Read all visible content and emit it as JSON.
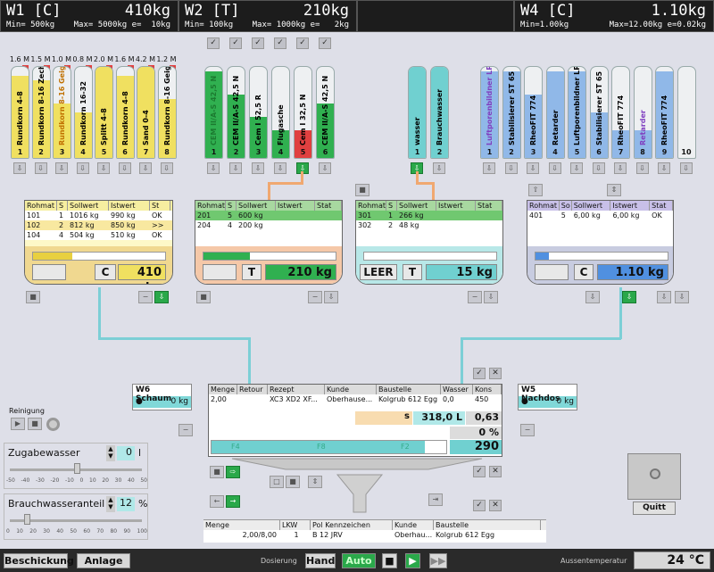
{
  "scales": [
    {
      "name": "W1",
      "mode": "[C]",
      "weight": "410kg",
      "min": "Min= 500kg",
      "max": "Max= 5000kg",
      "e": "e=  10kg"
    },
    {
      "name": "W2",
      "mode": "[T]",
      "weight": "210kg",
      "min": "Min= 100kg",
      "max": "Max= 1000kg",
      "e": "e=   2kg"
    },
    {
      "name": "W4",
      "mode": "[C]",
      "weight": "1.10kg",
      "min": "Min=1.00kg",
      "max": "Max=12.00kg",
      "e": "e=0.02kg"
    }
  ],
  "silos_w1": [
    {
      "qty": "1.6 M",
      "name": "Rundkorn 4-8",
      "num": "1",
      "level": 0.9,
      "color": "#f0e060",
      "text": "#000"
    },
    {
      "qty": "1.5 M",
      "name": "Rundkorn 8-16 Zech",
      "num": "2",
      "level": 0.85,
      "color": "#f0e060",
      "text": "#000"
    },
    {
      "qty": "1.0 M",
      "name": "Rundkorn 8-16 Geig",
      "num": "3",
      "level": 0.6,
      "color": "#f0e060",
      "text": "#c07000"
    },
    {
      "qty": "0.8 M",
      "name": "Rundkorn 16-32",
      "num": "4",
      "level": 0.5,
      "color": "#f0e060",
      "text": "#000"
    },
    {
      "qty": "2.0 M",
      "name": "Splitt 4-8",
      "num": "5",
      "level": 1.0,
      "color": "#f0e060",
      "text": "#000"
    },
    {
      "qty": "1.6 M",
      "name": "Rundkorn 4-8",
      "num": "6",
      "level": 0.9,
      "color": "#f0e060",
      "text": "#000"
    },
    {
      "qty": "4.2 M",
      "name": "Sand 0-4",
      "num": "7",
      "level": 1.0,
      "color": "#f0e060",
      "text": "#000"
    },
    {
      "qty": "1.2 M",
      "name": "Rundkorn 8-16 Geig",
      "num": "8",
      "level": 0.65,
      "color": "#f0e060",
      "text": "#000"
    }
  ],
  "silos_w2": [
    {
      "name": "CEM II/A-S 42,5 N",
      "num": "1",
      "level": 0.95,
      "color": "#30b050",
      "text": "#1c7a30"
    },
    {
      "name": "CEM II/A-S 42,5 N",
      "num": "2",
      "level": 0.7,
      "color": "#30b050",
      "text": "#000"
    },
    {
      "name": "Cem I 52,5 R",
      "num": "3",
      "level": 0.45,
      "color": "#30b050",
      "text": "#000"
    },
    {
      "name": "Flugasche",
      "num": "4",
      "level": 0.3,
      "color": "#30b050",
      "text": "#000"
    },
    {
      "name": "Cem I 32,5 N",
      "num": "5",
      "level": 0.3,
      "color": "#e04040",
      "text": "#000"
    },
    {
      "name": "CEM II/A-S 42,5 N",
      "num": "6",
      "level": 0.6,
      "color": "#30b050",
      "text": "#000"
    }
  ],
  "silos_water": [
    {
      "name": "wasser",
      "num": "1",
      "level": 1.0,
      "color": "#70d0d0",
      "text": "#000"
    },
    {
      "name": "Brauchwasser",
      "num": "2",
      "level": 1.0,
      "color": "#70d0d0",
      "text": "#000"
    }
  ],
  "silos_w4": [
    {
      "name": "Luftporenbildner LP",
      "num": "1",
      "level": 0.95,
      "color": "#90b8e8",
      "text": "#8040c0"
    },
    {
      "name": "Stabilisierer ST 65",
      "num": "2",
      "level": 0.95,
      "color": "#90b8e8",
      "text": "#000"
    },
    {
      "name": "RheoFIT 774",
      "num": "3",
      "level": 0.7,
      "color": "#90b8e8",
      "text": "#000"
    },
    {
      "name": "Retarder",
      "num": "4",
      "level": 0.95,
      "color": "#90b8e8",
      "text": "#000"
    },
    {
      "name": "Luftporenbildner LP",
      "num": "5",
      "level": 0.95,
      "color": "#90b8e8",
      "text": "#000"
    },
    {
      "name": "Stabilisierer ST 65",
      "num": "6",
      "level": 0.5,
      "color": "#90b8e8",
      "text": "#000"
    },
    {
      "name": "RheoFIT 774",
      "num": "7",
      "level": 0.3,
      "color": "#90b8e8",
      "text": "#000"
    },
    {
      "name": "Retarder",
      "num": "8",
      "level": 0.3,
      "color": "#90b8e8",
      "text": "#8040c0"
    },
    {
      "name": "RheoFIT 774",
      "num": "9",
      "level": 0.95,
      "color": "#90b8e8",
      "text": "#000"
    },
    {
      "name": "",
      "num": "10",
      "level": 0,
      "color": "#90b8e8",
      "text": "#000"
    }
  ],
  "panel1": {
    "headers": [
      "Rohmat",
      "S",
      "Sollwert",
      "Istwert",
      "St"
    ],
    "rows": [
      [
        "101",
        "1",
        "1016 kg",
        "990 kg",
        "OK"
      ],
      [
        "102",
        "2",
        "812 kg",
        "850 kg",
        ">>"
      ],
      [
        "104",
        "4",
        "504 kg",
        "510 kg",
        "OK"
      ]
    ],
    "label": "C",
    "value": "410 kg",
    "bar": 0.3
  },
  "panel2": {
    "headers": [
      "Rohmat",
      "S",
      "Sollwert",
      "Istwert",
      "Stat"
    ],
    "rows": [
      [
        "201",
        "5",
        "600 kg",
        "",
        ""
      ],
      [
        "204",
        "4",
        "200 kg",
        "",
        ""
      ]
    ],
    "label": "T",
    "value": "210 kg",
    "bar": 0.35
  },
  "panel3": {
    "headers": [
      "Rohmat",
      "S",
      "Sollwert",
      "Istwert",
      "Stat"
    ],
    "rows": [
      [
        "301",
        "1",
        "266 kg",
        "",
        ""
      ],
      [
        "302",
        "2",
        "48 kg",
        "",
        ""
      ]
    ],
    "label1": "LEER",
    "label": "T",
    "value": "15 kg",
    "bar": 0.0
  },
  "panel4": {
    "headers": [
      "Rohmat",
      "So",
      "Sollwert",
      "Istwert",
      "Stat"
    ],
    "rows": [
      [
        "401",
        "5",
        "6,00 kg",
        "6,00 kg",
        "OK"
      ]
    ],
    "label": "C",
    "value": "1.10 kg",
    "bar": 0.1
  },
  "w6": {
    "title": "W6 Schaum",
    "value": "0 kg"
  },
  "w5": {
    "title": "W5 Nachdos",
    "value": "0 kg"
  },
  "mixer": {
    "headers": [
      "Menge",
      "Retour",
      "Rezept",
      "Kunde",
      "Baustelle",
      "Wasser",
      "Kons"
    ],
    "row": [
      "2,00",
      "",
      "XC3 XD2 XF...",
      "Oberhause...",
      "Kolgrub 612 Egg",
      "0,0",
      "450"
    ],
    "s_label": "s",
    "water": "318,0 L",
    "ratio": "0,63",
    "percent": "0 %",
    "f4": "F4",
    "f8": "F8",
    "f2": "F2",
    "total": "290"
  },
  "reinigung": {
    "label": "Reinigung"
  },
  "zugabe": {
    "label": "Zugabewasser",
    "value": "0",
    "unit": "l",
    "ticks": [
      "-50",
      "-40",
      "-30",
      "-20",
      "-10",
      "0",
      "10",
      "20",
      "30",
      "40",
      "50"
    ]
  },
  "brauch": {
    "label": "Brauchwasseranteil",
    "value": "12",
    "unit": "%",
    "ticks": [
      "0",
      "10",
      "20",
      "30",
      "40",
      "50",
      "60",
      "70",
      "80",
      "90",
      "100"
    ]
  },
  "quitt": "Quitt",
  "bottom": {
    "headers": [
      "Menge",
      "LKW",
      "Pol Kennzeichen",
      "Kunde",
      "Baustelle"
    ],
    "row": [
      "2,00/8,00",
      "1",
      "B 12 JRV",
      "Oberhau...",
      "Kolgrub 612 Egg"
    ]
  },
  "footer": {
    "beschickung": "Beschickung",
    "anlage": "Anlage",
    "dosierung": "Dosierung",
    "hand": "Hand",
    "auto": "Auto",
    "aussentemp_label": "Aussentemperatur",
    "aussentemp": "24 °C"
  }
}
